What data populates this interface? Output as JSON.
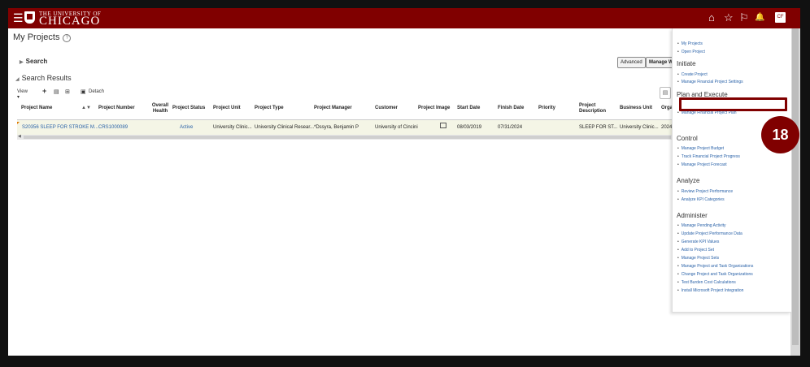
{
  "header": {
    "logo_top": "THE UNIVERSITY OF",
    "logo_main": "CHICAGO",
    "menu_glyph": "☰",
    "icons": [
      "home-icon",
      "star-icon",
      "flag-icon",
      "bell-icon"
    ],
    "home_glyph": "⌂",
    "star_glyph": "☆",
    "flag_glyph": "⚐",
    "bell_glyph": "🔔",
    "avatar_initials": "CF",
    "brand_color": "#800000"
  },
  "page": {
    "title": "My Projects",
    "help_glyph": "?",
    "search_label": "Search",
    "results_label": "Search Results",
    "advanced_label": "Advanced",
    "manage_label": "Manage Wa"
  },
  "toolbar": {
    "view_label": "View ▾",
    "add_glyph": "+",
    "doc_glyph": "▤",
    "tools_glyph": "⊞",
    "detach_label": "Detach"
  },
  "table": {
    "columns": [
      "Project Name",
      "▲▼",
      "Project Number",
      "Overall Health",
      "Project Status",
      "Project Unit",
      "Project Type",
      "Project Manager",
      "Customer",
      "Project Image",
      "Start Date",
      "Finish Date",
      "Priority",
      "Project Description",
      "Business Unit",
      "Orga"
    ],
    "rows": [
      {
        "project_name": "S20356 SLEEP FOR STROKE M...",
        "project_number": "CRS1000089",
        "overall_health": "",
        "project_status": "Active",
        "project_unit": "University Clinic...",
        "project_type": "University Clinical Resear...",
        "project_manager": "*Dssyra, Benjamin P",
        "customer": "University of Cincini",
        "start_date": "08/03/2019",
        "finish_date": "07/31/2024",
        "priority": "",
        "project_description": "SLEEP FOR ST...",
        "business_unit": "University Clinic...",
        "organization": "2024"
      }
    ]
  },
  "panel": {
    "top_links": [
      "My Projects",
      "Open Project"
    ],
    "sections": [
      {
        "title": "Initiate",
        "links": [
          "Create Project",
          "Manage Financial Project Settings"
        ]
      },
      {
        "title": "Plan and Execute",
        "links": [
          "Manage Financial Project Plan"
        ]
      },
      {
        "title": "Control",
        "links": [
          "Manage Project Budget",
          "Track Financial Project Progress",
          "Manage Project Forecast"
        ]
      },
      {
        "title": "Analyze",
        "links": [
          "Review Project Performance",
          "Analyze KPI Categories"
        ]
      },
      {
        "title": "Administer",
        "links": [
          "Manage Pending Activity",
          "Update Project Performance Data",
          "Generate KPI Values",
          "Add to Project Set",
          "Manage Project Sets",
          "Manage Project and Task Organizations",
          "Change Project and Task Organizations",
          "Test Burden Cost Calculations",
          "Install Microsoft Project Integration"
        ]
      }
    ],
    "panel_glyph": "▤"
  },
  "callout": {
    "step_number": "18"
  }
}
